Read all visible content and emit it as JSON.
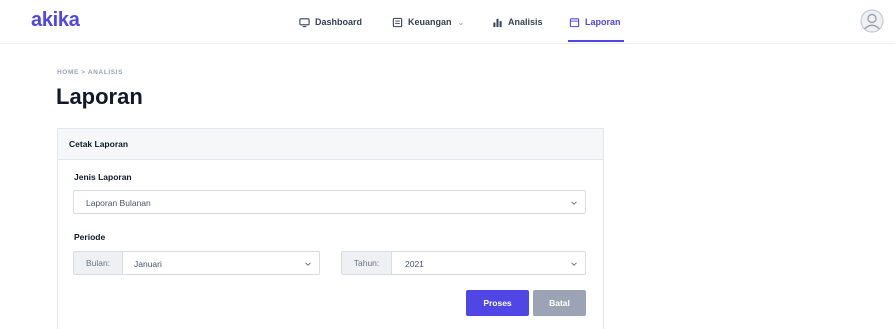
{
  "app": {
    "logo": "akika"
  },
  "nav": {
    "items": [
      {
        "label": "Dashboard",
        "icon": "monitor-icon"
      },
      {
        "label": "Keuangan",
        "icon": "ledger-icon",
        "has_dropdown": true
      },
      {
        "label": "Analisis",
        "icon": "bar-chart-icon"
      },
      {
        "label": "Laporan",
        "icon": "report-icon",
        "active": true
      }
    ],
    "avatar_icon": "user-avatar-icon"
  },
  "breadcrumb": "HOME > ANALISIS",
  "page": {
    "title": "Laporan"
  },
  "card": {
    "title": "Cetak Laporan",
    "report_type": {
      "label": "Jenis Laporan",
      "value": "Laporan Bulanan"
    },
    "period": {
      "label": "Periode",
      "month_addon": "Bulan:",
      "month_value": "Januari",
      "year_addon": "Tahun:",
      "year_value": "2021"
    },
    "buttons": {
      "process": "Proses",
      "cancel": "Batal"
    }
  },
  "colors": {
    "accent": "#4f46e5",
    "secondary_button": "#9ca3b4",
    "card_header_bg": "#f6f7f9"
  }
}
